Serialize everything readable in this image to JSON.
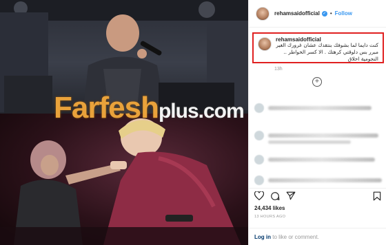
{
  "header": {
    "username": "rehamsaidofficial",
    "follow_label": "Follow",
    "separator": "•"
  },
  "caption": {
    "username": "rehamsaidofficial",
    "text": "كنت دايما لما بشوفك بنتقدك عشان غرورك الغير مبرر بس دلوقتي كرهتك . الا كسر الخواطر .. النجومية اخلاق"
  },
  "time_ago": "13h",
  "likes": "24,434 likes",
  "posted": "13 HOURS AGO",
  "login": {
    "link": "Log in",
    "rest": " to like or comment."
  },
  "watermark": {
    "main": "Farfesh",
    "suffix": "plus.com"
  },
  "icons": {
    "verified": "verified-badge-icon",
    "more": "plus-circle-icon",
    "like": "heart-icon",
    "comment": "comment-bubble-icon",
    "share": "share-arrow-icon",
    "save": "bookmark-icon"
  },
  "colors": {
    "link_blue": "#3897f0",
    "highlight_red": "#e02020",
    "watermark_orange": "#e9a23b"
  }
}
